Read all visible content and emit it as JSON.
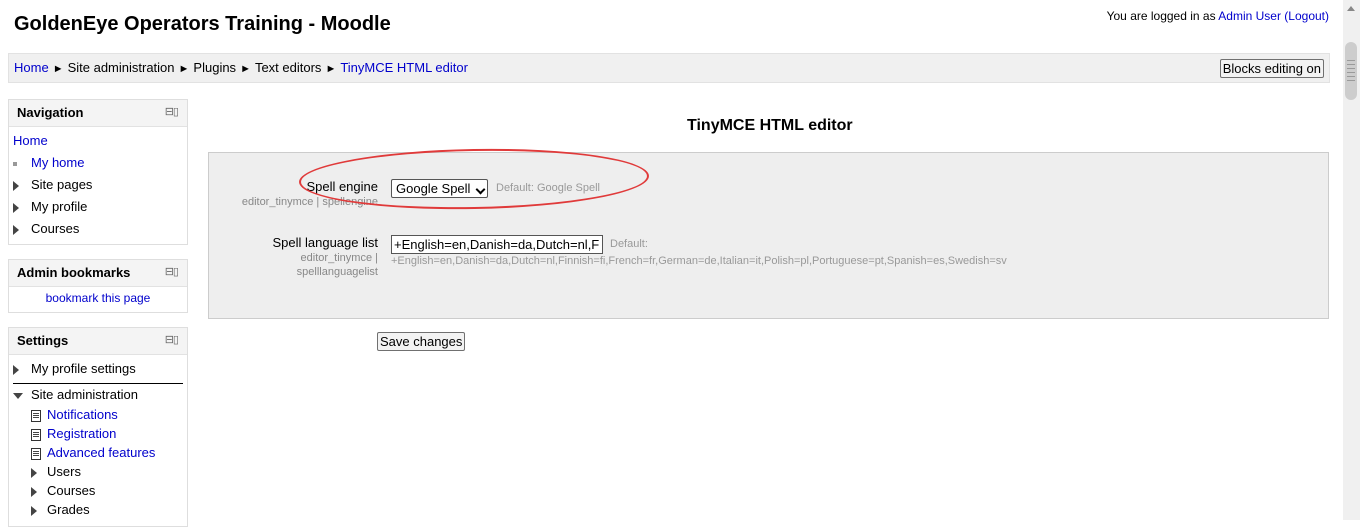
{
  "header": {
    "site_title": "GoldenEye Operators Training - Moodle",
    "logged_in_prefix": "You are logged in as ",
    "user_name": "Admin User",
    "logout_label": "(Logout)"
  },
  "breadcrumb": {
    "items": [
      "Home",
      "Site administration",
      "Plugins",
      "Text editors",
      "TinyMCE HTML editor"
    ],
    "separator": "►"
  },
  "blocks_editing_button": "Blocks editing on",
  "navigation": {
    "title": "Navigation",
    "home": "Home",
    "items": [
      "My home",
      "Site pages",
      "My profile",
      "Courses"
    ]
  },
  "admin_bookmarks": {
    "title": "Admin bookmarks",
    "link": "bookmark this page"
  },
  "settings_block": {
    "title": "Settings",
    "items": [
      "My profile settings",
      "Site administration"
    ],
    "site_admin_children": [
      {
        "label": "Notifications",
        "kind": "link"
      },
      {
        "label": "Registration",
        "kind": "link"
      },
      {
        "label": "Advanced features",
        "kind": "link"
      },
      {
        "label": "Users",
        "kind": "folder"
      },
      {
        "label": "Courses",
        "kind": "folder"
      },
      {
        "label": "Grades",
        "kind": "folder"
      }
    ]
  },
  "main": {
    "heading": "TinyMCE HTML editor",
    "spell_engine": {
      "label": "Spell engine",
      "sub": "editor_tinymce | spellengine",
      "value": "Google Spell",
      "default": "Default: Google Spell"
    },
    "spell_language": {
      "label": "Spell language list",
      "sub1": "editor_tinymce |",
      "sub2": "spelllanguagelist",
      "value": "+English=en,Danish=da,Dutch=nl,Finnish=fi,French=fr,German=de,Italian=it,Polish=pl,Portuguese=pt,Spanish=es,Swedish=sv",
      "default_label": "Default:",
      "default_value": "+English=en,Danish=da,Dutch=nl,Finnish=fi,French=fr,German=de,Italian=it,Polish=pl,Portuguese=pt,Spanish=es,Swedish=sv"
    },
    "save_button": "Save changes"
  },
  "colors": {
    "link": "#0000cc",
    "annotation": "#e03a3a",
    "settings_bg": "#eeeeee"
  }
}
